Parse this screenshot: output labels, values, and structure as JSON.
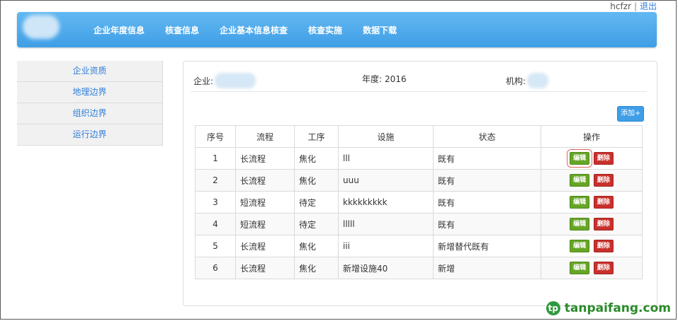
{
  "user": {
    "name": "hcfzr",
    "separator": "|",
    "logout": "退出"
  },
  "nav": {
    "items": [
      "企业年度信息",
      "核查信息",
      "企业基本信息核查",
      "核查实施",
      "数据下载"
    ]
  },
  "sidebar": {
    "items": [
      "企业资质",
      "地理边界",
      "组织边界",
      "运行边界"
    ]
  },
  "info": {
    "company_label": "企业:",
    "year_label": "年度:",
    "year_value": "2016",
    "org_label": "机构:"
  },
  "add_button": "添加+",
  "table": {
    "headers": [
      "序号",
      "流程",
      "工序",
      "设施",
      "状态",
      "操作"
    ],
    "rows": [
      {
        "no": "1",
        "flow": "长流程",
        "process": "焦化",
        "facility": "lll",
        "status": "既有"
      },
      {
        "no": "2",
        "flow": "长流程",
        "process": "焦化",
        "facility": "uuu",
        "status": "既有"
      },
      {
        "no": "3",
        "flow": "短流程",
        "process": "待定",
        "facility": "kkkkkkkkk",
        "status": "既有"
      },
      {
        "no": "4",
        "flow": "短流程",
        "process": "待定",
        "facility": "lllll",
        "status": "既有"
      },
      {
        "no": "5",
        "flow": "长流程",
        "process": "焦化",
        "facility": "iii",
        "status": "新增替代既有"
      },
      {
        "no": "6",
        "flow": "长流程",
        "process": "焦化",
        "facility": "新增设施40",
        "status": "新增"
      }
    ],
    "edit_label": "编辑",
    "delete_label": "删除"
  },
  "watermark": {
    "text": "tanpaifang.com"
  },
  "colors": {
    "nav": "#3f9ee6",
    "link": "#2f7ed8",
    "edit": "#67a527",
    "delete": "#c9302c"
  }
}
